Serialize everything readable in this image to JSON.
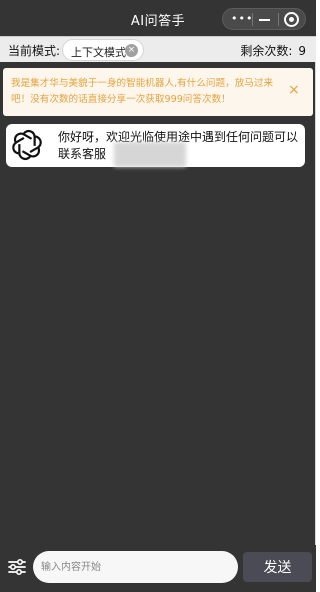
{
  "header": {
    "title": "AI问答手",
    "capsule": {
      "more_icon": "ellipsis-icon",
      "more_glyph": "•••",
      "minimize_icon": "minimize-icon",
      "target_icon": "target-icon"
    }
  },
  "mode_bar": {
    "mode_label": "当前模式:",
    "mode_value": "上下文模式",
    "clear_icon": "clear-icon",
    "clear_glyph": "×",
    "remaining_label": "剩余次数:",
    "remaining_count": "9"
  },
  "notice": {
    "text": "我是集才华与美貌于一身的智能机器人,有什么问题，放马过来吧！没有次数的话直接分享一次获取999问答次数！",
    "close_glyph": "×",
    "color": "#e6a23c"
  },
  "messages": [
    {
      "avatar_icon": "openai-logo-icon",
      "text": "你好呀，欢迎光临使用途中遇到任何问题可以联系客服"
    }
  ],
  "composer": {
    "settings_icon": "sliders-icon",
    "placeholder": "输入内容开始",
    "value": "",
    "send_label": "发送"
  },
  "colors": {
    "background": "#343434",
    "mode_bar": "#ececec",
    "notice_bg": "#fdf6ec",
    "send_button": "#4b4b55"
  }
}
